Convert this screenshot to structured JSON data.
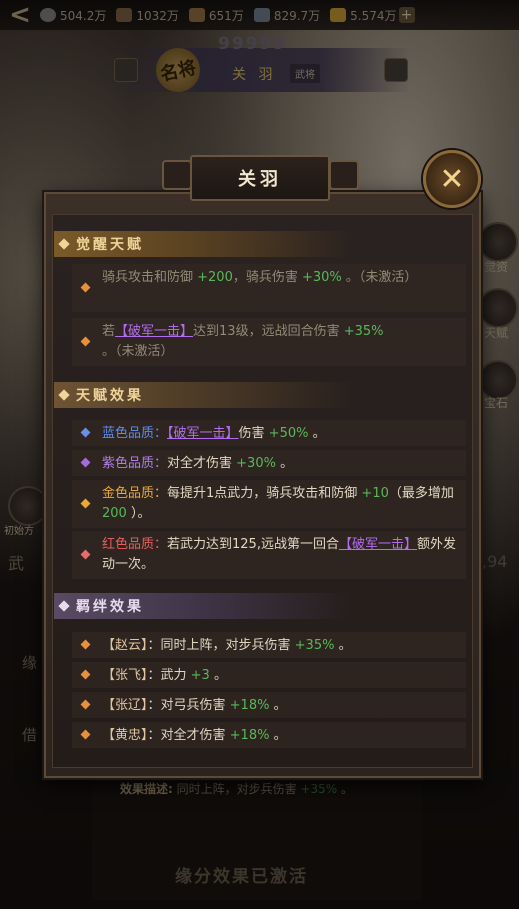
{
  "resources": [
    {
      "value": "504.2万",
      "icon": "silver-coin-icon",
      "color": "#8c8c8c"
    },
    {
      "value": "1032万",
      "icon": "wood-icon",
      "color": "#8a6a4a"
    },
    {
      "value": "651万",
      "icon": "food-icon",
      "color": "#a07a4a"
    },
    {
      "value": "829.7万",
      "icon": "iron-icon",
      "color": "#7a8a9a"
    },
    {
      "value": "5.574万",
      "icon": "gold-ingot-icon",
      "color": "#d8a83a"
    }
  ],
  "plus_label": "+",
  "back_label": "<",
  "hero_header": {
    "rank_digits": "99999",
    "name": "关 羽",
    "tag": "武将",
    "seal": "名将"
  },
  "side_labels": {
    "right_1": "觉资",
    "right_2": "天赋",
    "right_3": "宝石",
    "left_1": "初始方",
    "left_frag": "武",
    "right_number": ",94",
    "left_tab": "缘",
    "left_tab2": "借"
  },
  "modal": {
    "title": "关羽",
    "close_label": "✕",
    "sections": {
      "awaken": {
        "header": "觉醒天赋",
        "row1": {
          "a": "骑兵攻击和防御 ",
          "v1": "+200",
          "b": "，骑兵伤害 ",
          "v2": "+30%",
          "c": " 。（未激活）"
        },
        "row2": {
          "a": "若",
          "skill": "【破军一击】",
          "b": "达到13级，远战回合伤害 ",
          "v": "+35%",
          "c": " 。（未激活）"
        }
      },
      "talent": {
        "header": "天赋效果",
        "blue": {
          "q": "蓝色品质：",
          "skill": "【破军一击】",
          "a": "伤害 ",
          "v": "+50%",
          "b": " 。"
        },
        "purple": {
          "q": "紫色品质：",
          "a": "对全才伤害 ",
          "v": "+30%",
          "b": " 。"
        },
        "gold": {
          "q": "金色品质：",
          "a": "每提升1点武力，骑兵攻击和防御 ",
          "v1": "+10",
          "b": "（最多增加 ",
          "v2": "200",
          "c": " ）。"
        },
        "red": {
          "q": "红色品质：",
          "a": "若武力达到125,远战第一回合",
          "skill": "【破军一击】",
          "b": "额外发动一次。"
        }
      },
      "bond": {
        "header": "羁绊效果",
        "rows": [
          {
            "hero": "【赵云】",
            "a": "：同时上阵，对步兵伤害 ",
            "v": "+35%",
            "b": " 。"
          },
          {
            "hero": "【张飞】",
            "a": "：武力 ",
            "v": "+3",
            "b": " 。"
          },
          {
            "hero": "【张辽】",
            "a": "：对弓兵伤害 ",
            "v": "+18%",
            "b": " 。"
          },
          {
            "hero": "【黄忠】",
            "a": "：对全才伤害 ",
            "v": "+18%",
            "b": " 。"
          }
        ]
      }
    }
  },
  "bottom": {
    "desc_label": "效果描述:",
    "desc_text": " 同时上阵，对步兵伤害 ",
    "desc_value": "+35%",
    "desc_end": " 。",
    "active_text": "缘分效果已激活"
  }
}
